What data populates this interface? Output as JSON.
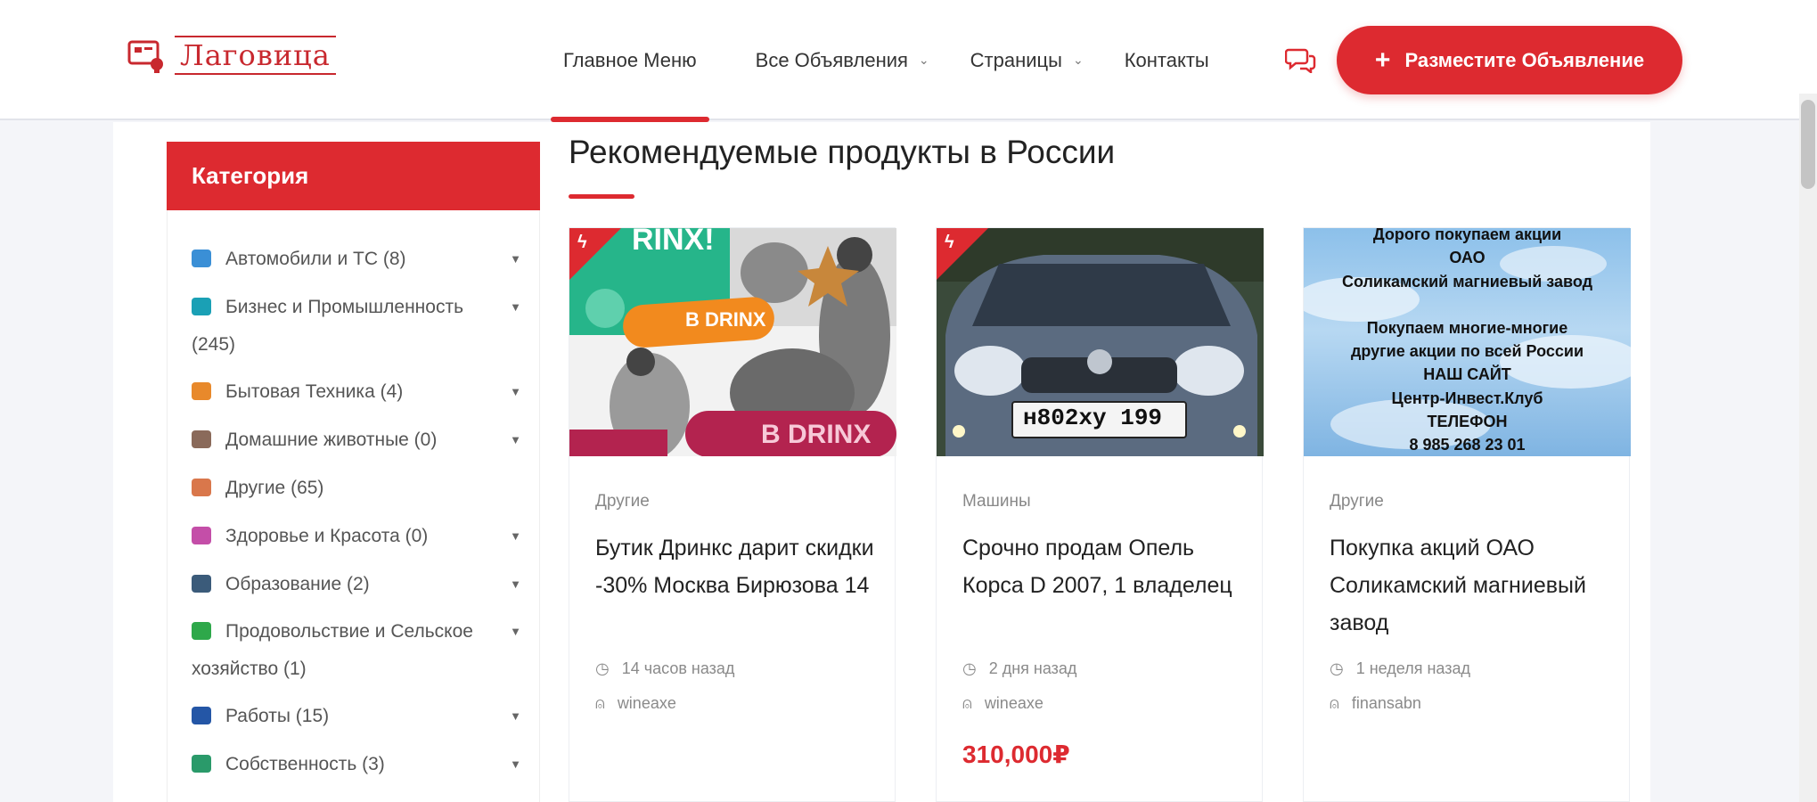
{
  "brand": {
    "name": "Лаговица",
    "accent": "#dd2a30"
  },
  "nav": {
    "items": [
      {
        "label": "Главное Меню",
        "active": true,
        "dropdown": false
      },
      {
        "label": "Все Объявления",
        "active": false,
        "dropdown": true
      },
      {
        "label": "Страницы",
        "active": false,
        "dropdown": true
      },
      {
        "label": "Контакты",
        "active": false,
        "dropdown": false
      }
    ],
    "chat_icon": "chat-bubbles-icon",
    "post_button": "Разместите Объявление"
  },
  "sidebar": {
    "title": "Категория",
    "categories": [
      {
        "line1": "Автомобили и ТС (8)",
        "line2": "",
        "icon": "car-icon",
        "color": "#3a8fd6",
        "dropdown": true
      },
      {
        "line1": "Бизнес и Промышленность",
        "line2": "(245)",
        "icon": "factory-icon",
        "color": "#1aa0b5",
        "dropdown": true
      },
      {
        "line1": "Бытовая Техника (4)",
        "line2": "",
        "icon": "appliance-icon",
        "color": "#e8892b",
        "dropdown": true
      },
      {
        "line1": "Домашние животные (0)",
        "line2": "",
        "icon": "paw-icon",
        "color": "#8a6a5a",
        "dropdown": true
      },
      {
        "line1": "Другие (65)",
        "line2": "",
        "icon": "hourglass-icon",
        "color": "#d9774b",
        "dropdown": false
      },
      {
        "line1": "Здоровье и Красота (0)",
        "line2": "",
        "icon": "beauty-icon",
        "color": "#c44ea8",
        "dropdown": true
      },
      {
        "line1": "Образование (2)",
        "line2": "",
        "icon": "graduation-cap-icon",
        "color": "#3b5b7a",
        "dropdown": true
      },
      {
        "line1": "Продовольствие и Сельское",
        "line2": "хозяйство (1)",
        "icon": "plant-icon",
        "color": "#2ea84a",
        "dropdown": true
      },
      {
        "line1": "Работы (15)",
        "line2": "",
        "icon": "briefcase-icon",
        "color": "#2456a6",
        "dropdown": true
      },
      {
        "line1": "Собственность (3)",
        "line2": "",
        "icon": "property-icon",
        "color": "#2a9a6a",
        "dropdown": true
      }
    ]
  },
  "section": {
    "title": "Рекомендуемые продукты в России"
  },
  "cards": [
    {
      "category": "Другие",
      "title": "Бутик Дринкс дарит скидки -30% Москва Бирюзова 14",
      "time": "14 часов назад",
      "author": "wineaxe",
      "price": "",
      "image": {
        "top_text": "RINX!",
        "label1": "B DRINX",
        "label2": "B DRINX"
      }
    },
    {
      "category": "Машины",
      "title": "Срочно продам Опель Корса D 2007, 1 владелец",
      "time": "2 дня назад",
      "author": "wineaxe",
      "price": "310,000₽",
      "image": {
        "plate": "н802ху 199"
      }
    },
    {
      "category": "Другие",
      "title": "Покупка акций ОАО Соликамский магниевый завод",
      "time": "1 неделя назад",
      "author": "finansabn",
      "price": "",
      "image": {
        "lines": [
          "Дорого покупаем акции",
          "ОАО",
          "Соликамский магниевый завод",
          "",
          "Покупаем многие-многие",
          "другие акции по всей России",
          "НАШ САЙТ",
          "Центр-Инвест.Клуб",
          "ТЕЛЕФОН",
          "8 985 268 23 01"
        ]
      }
    }
  ]
}
